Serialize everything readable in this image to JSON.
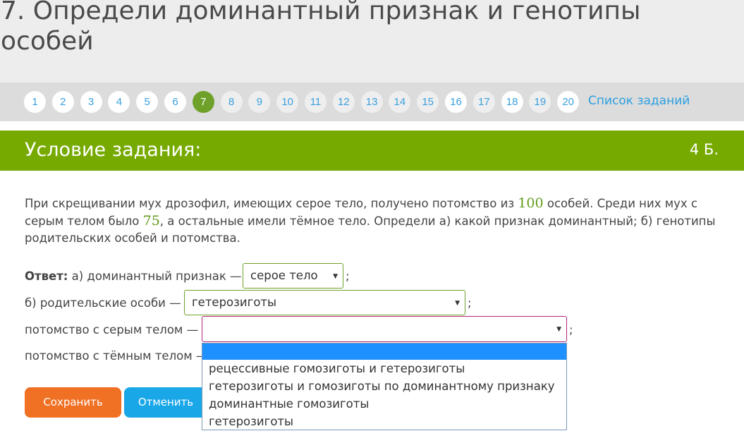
{
  "page": {
    "title": "7. Определи доминантный признак и генотипы особей"
  },
  "task_nav": {
    "numbers": [
      "1",
      "2",
      "3",
      "4",
      "5",
      "6",
      "7",
      "8",
      "9",
      "10",
      "11",
      "12",
      "13",
      "14",
      "15",
      "16",
      "17",
      "18",
      "19",
      "20"
    ],
    "active": "7",
    "task_list_label": "Список заданий"
  },
  "condition": {
    "heading": "Условие задания:",
    "points": "4 Б."
  },
  "problem": {
    "part1": "При скрещивании мух дрозофил, имеющих серое тело, получено потомство из ",
    "num1": "100",
    "part2": " особей. Среди них мух с серым телом было ",
    "num2": "75",
    "part3": ", а остальные имели тёмное тело. Определи а) какой признак доминантный; б) генотипы родительских особей и потомства."
  },
  "answer": {
    "label": "Ответ:",
    "row_a_text": " а) доминантный признак —",
    "row_a_value": "серое тело",
    "row_b_text": "б) родительские особи —",
    "row_b_value": "гетерозиготы",
    "row_c_text": "потомство с серым телом —",
    "row_c_value": "",
    "row_d_text": "потомство с тёмным телом —",
    "semicolon": ";"
  },
  "dropdown": {
    "options": [
      "",
      "рецессивные гомозиготы и гетерозиготы",
      "гетерозиготы и гомозиготы по доминантному признаку",
      "доминантные гомозиготы",
      "гетерозиготы"
    ]
  },
  "buttons": {
    "save": "Сохранить",
    "cancel": "Отменить"
  },
  "colors": {
    "accent_green": "#76aa00",
    "active_circle": "#6fa12a",
    "save_orange": "#f07024",
    "cancel_blue": "#1aa7e8",
    "dropdown_highlight": "#1e90ff"
  }
}
